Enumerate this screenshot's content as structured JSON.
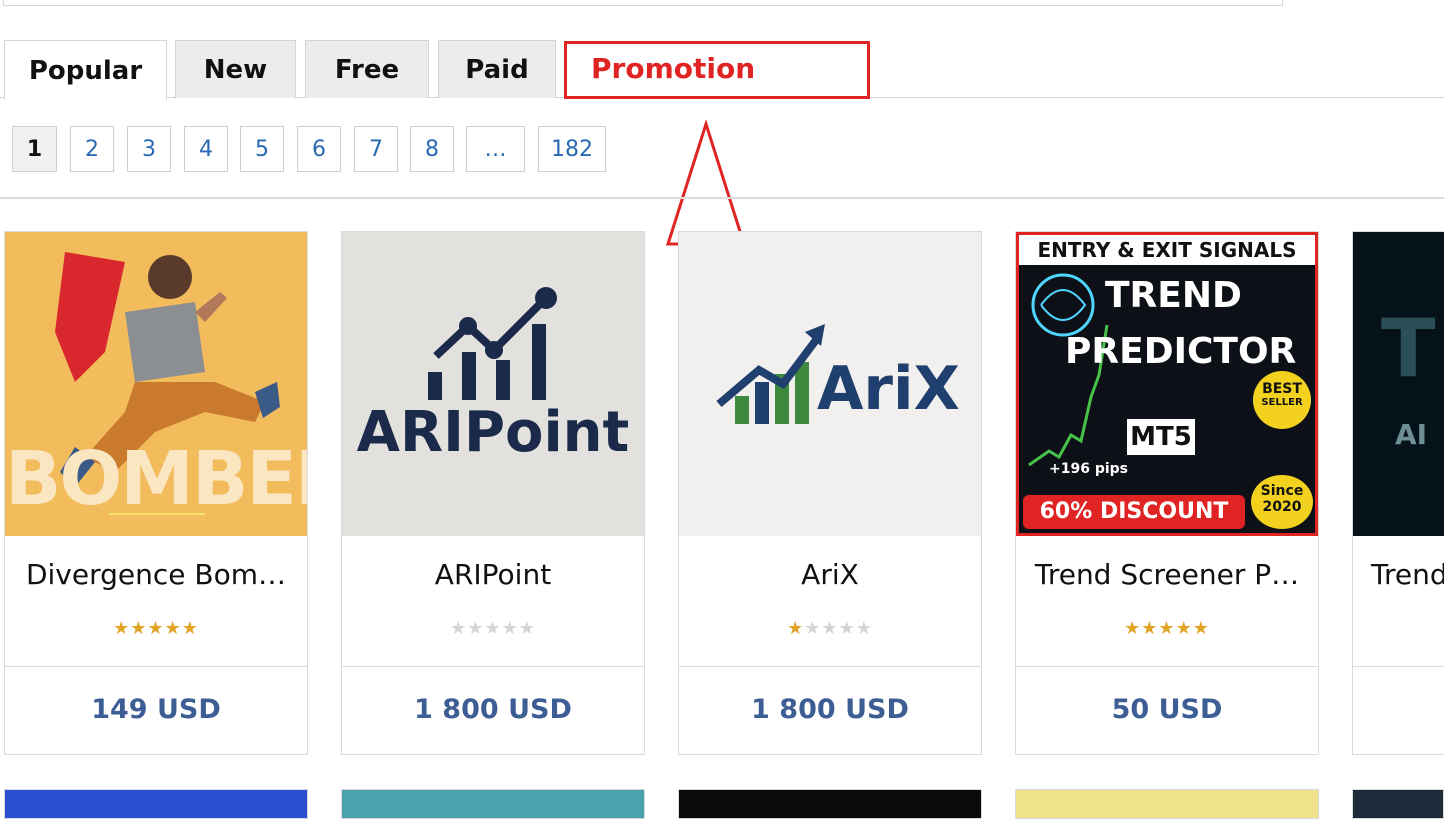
{
  "tabs": [
    {
      "label": "Popular",
      "active": true
    },
    {
      "label": "New",
      "active": false
    },
    {
      "label": "Free",
      "active": false
    },
    {
      "label": "Paid",
      "active": false
    }
  ],
  "promotion_tab": {
    "label": "Promotion"
  },
  "pagination": {
    "current": "1",
    "pages": [
      "2",
      "3",
      "4",
      "5",
      "6",
      "7",
      "8",
      "…",
      "182"
    ]
  },
  "products": [
    {
      "name": "Divergence Bom…",
      "rating": 5,
      "price": "149 USD",
      "logo_text": "BOMBER"
    },
    {
      "name": "ARIPoint",
      "rating": 0,
      "price": "1 800 USD",
      "logo_text": "ARIPoint"
    },
    {
      "name": "AriX",
      "rating": 1,
      "price": "1 800 USD",
      "logo_text": "AriX"
    },
    {
      "name": "Trend Screener P…",
      "rating": 5,
      "price": "50 USD",
      "banner": {
        "top": "ENTRY & EXIT SIGNALS",
        "title1": "TREND",
        "title2": "PREDICTOR",
        "platform": "MT5",
        "pips": "+196 pips",
        "discount": "60% DISCOUNT",
        "badge1": "BEST",
        "badge2": "SELLER",
        "since": "Since",
        "year": "2020"
      }
    },
    {
      "name": "Trend",
      "logo_text": "T",
      "logo_sub": "AI"
    }
  ],
  "colors": {
    "accent_red": "#e02424",
    "price_blue": "#3d5e94",
    "link_blue": "#2a6ab3",
    "star_gold": "#e0a427"
  }
}
